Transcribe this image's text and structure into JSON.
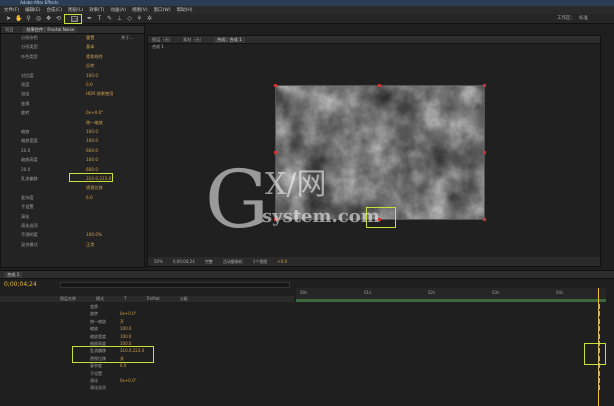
{
  "app": {
    "title": "Adobe After Effects"
  },
  "menu": [
    "文件(F)",
    "编辑(E)",
    "合成(C)",
    "图层(L)",
    "效果(T)",
    "动画(A)",
    "视图(V)",
    "窗口(W)",
    "帮助(H)"
  ],
  "toolbar": {
    "workspace_label": "工作区：",
    "workspace_value": "标准"
  },
  "left_panel": {
    "tabs": [
      "项目",
      "效果控件：Fractal Noise"
    ],
    "rows": [
      {
        "label": "分形杂色",
        "value": "重置",
        "extra": "关于..."
      },
      {
        "label": "分形类型",
        "value": "基本"
      },
      {
        "label": "杂色类型",
        "value": "柔和线性"
      },
      {
        "label": "",
        "value": "反转"
      },
      {
        "label": "对比度",
        "value": "100.0"
      },
      {
        "label": "亮度",
        "value": "0.0"
      },
      {
        "label": "溢出",
        "value": "HDR 效果使用"
      },
      {
        "label": "变换",
        "value": ""
      },
      {
        "label": "旋转",
        "value": "0x+0.0°"
      },
      {
        "label": "",
        "value": "统一缩放"
      },
      {
        "label": "缩放",
        "value": "100.0"
      },
      {
        "label": "缩放宽度",
        "value": "100.0"
      },
      {
        "label": "20.0",
        "value": "600.0"
      },
      {
        "label": "缩放高度",
        "value": "100.0"
      },
      {
        "label": "20.0",
        "value": "600.0"
      },
      {
        "label": "乱流偏移",
        "value": "310.0,223.0"
      },
      {
        "label": "",
        "value": "透视位移"
      },
      {
        "label": "复杂度",
        "value": "6.0"
      },
      {
        "label": "子设置",
        "value": ""
      },
      {
        "label": "演化",
        "value": ""
      },
      {
        "label": "演化选项",
        "value": ""
      },
      {
        "label": "不透明度",
        "value": "100.0%"
      },
      {
        "label": "混合模式",
        "value": "正常"
      }
    ]
  },
  "comp_panel": {
    "tabs": [
      "图层（无）",
      "素材（无）",
      "合成：合成 1"
    ],
    "breadcrumb": "合成 1",
    "bottom_bar": [
      "50%",
      "0;00;04;24",
      "完整",
      "活动摄像机",
      "1个视图",
      "+0.0"
    ]
  },
  "watermark": {
    "big": "G",
    "mid": "X/网",
    "small": "system.com"
  },
  "timeline": {
    "tab": "合成 1",
    "timecode": "0;00;04;24",
    "header_cols": [
      "图层名称",
      "模式",
      "T",
      "TrkMat",
      "父级"
    ],
    "ruler": [
      "00s",
      "01s",
      "02s",
      "03s",
      "04s"
    ],
    "rows": [
      {
        "label": "变换",
        "value": ""
      },
      {
        "label": "旋转",
        "value": "0x+0.0°"
      },
      {
        "label": "统一缩放",
        "value": "开"
      },
      {
        "label": "缩放",
        "value": "100.0"
      },
      {
        "label": "缩放宽度",
        "value": "100.0"
      },
      {
        "label": "缩放高度",
        "value": "100.0"
      },
      {
        "label": "乱流偏移",
        "value": "310.0,223.0"
      },
      {
        "label": "透视位移",
        "value": "关"
      },
      {
        "label": "复杂度",
        "value": "6.0"
      },
      {
        "label": "子设置",
        "value": ""
      },
      {
        "label": "演化",
        "value": "0x+0.0°"
      },
      {
        "label": "演化选项",
        "value": ""
      }
    ]
  },
  "colors": {
    "accent": "#c8e03a",
    "value": "#d3a24a",
    "playhead": "#f0c040"
  }
}
